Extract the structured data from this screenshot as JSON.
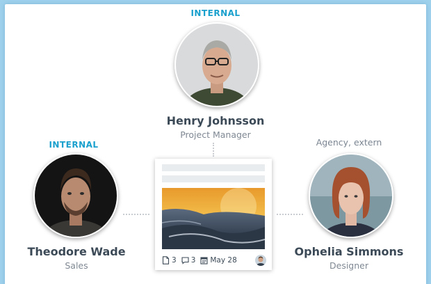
{
  "colors": {
    "accent": "#1aa0cd",
    "name_text": "#3c4a57",
    "muted_text": "#7f8893",
    "background": "#9ed1ec"
  },
  "top": {
    "tag": "INTERNAL",
    "name": "Henry Johnsson",
    "role": "Project Manager"
  },
  "left": {
    "tag": "INTERNAL",
    "name": "Theodore Wade",
    "role": "Sales"
  },
  "right": {
    "tag": "Agency, extern",
    "name": "Ophelia Simmons",
    "role": "Designer"
  },
  "task_card": {
    "file_count": "3",
    "comment_count": "3",
    "due_date": "May 28",
    "icons": [
      "document-icon",
      "comment-icon",
      "calendar-icon",
      "assignee-avatar"
    ]
  }
}
